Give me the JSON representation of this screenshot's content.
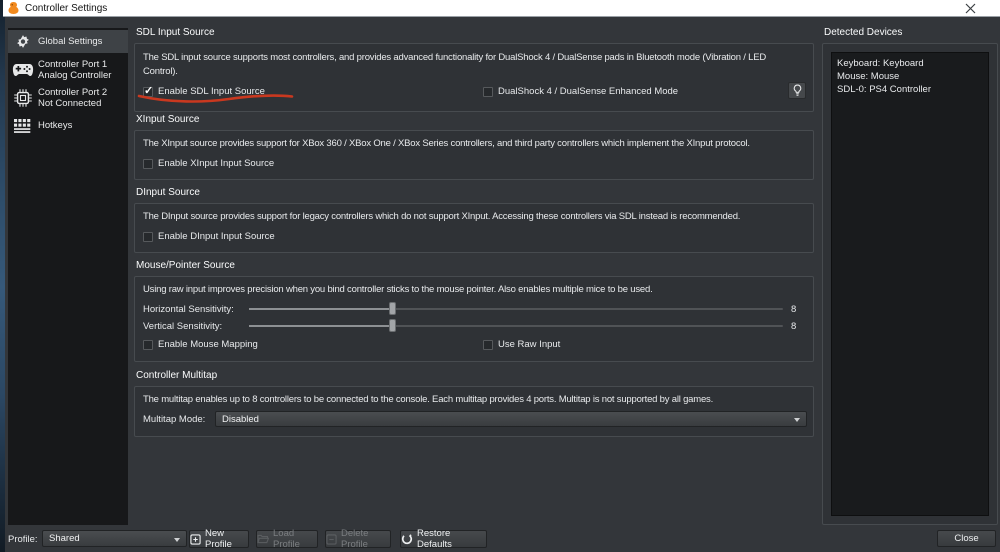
{
  "titlebar": {
    "title": "Controller Settings"
  },
  "colors": {
    "annotation_red": "#c9381f",
    "titlebar_bg": "#ffffff",
    "selection_bg": "#3e4246",
    "accent_orange": "#f28a1e"
  },
  "glyphs": {
    "check": "✓"
  },
  "sidebar": {
    "items": [
      {
        "label": "Global Settings",
        "icon": "gear-icon",
        "selected": true
      },
      {
        "label": "Controller Port 1",
        "sublabel": "Analog Controller",
        "icon": "gamepad-icon",
        "selected": false
      },
      {
        "label": "Controller Port 2",
        "sublabel": "Not Connected",
        "icon": "chip-icon",
        "selected": false
      },
      {
        "label": "Hotkeys",
        "icon": "hotkeys-icon",
        "selected": false
      }
    ]
  },
  "sdl": {
    "heading": "SDL Input Source",
    "description": "The SDL input source supports most controllers, and provides advanced functionality for DualShock 4 / DualSense pads in Bluetooth mode (Vibration / LED Control).",
    "enable_label": "Enable SDL Input Source",
    "enable_checked": true,
    "enhanced_label": "DualShock 4 / DualSense Enhanced Mode",
    "enhanced_checked": false
  },
  "xinput": {
    "heading": "XInput Source",
    "description": "The XInput source provides support for XBox 360 / XBox One / XBox Series controllers, and third party controllers which implement the XInput protocol.",
    "enable_label": "Enable XInput Input Source",
    "enable_checked": false
  },
  "dinput": {
    "heading": "DInput Source",
    "description": "The DInput source provides support for legacy controllers which do not support XInput. Accessing these controllers via SDL instead is recommended.",
    "enable_label": "Enable DInput Input Source",
    "enable_checked": false
  },
  "mouse": {
    "heading": "Mouse/Pointer Source",
    "description": "Using raw input improves precision when you bind controller sticks to the mouse pointer. Also enables multiple mice to be used.",
    "horizontal_label": "Horizontal Sensitivity:",
    "horizontal_value": "8",
    "vertical_label": "Vertical Sensitivity:",
    "vertical_value": "8",
    "slider_percent": 27,
    "mapping_label": "Enable Mouse Mapping",
    "mapping_checked": false,
    "raw_label": "Use Raw Input",
    "raw_checked": false
  },
  "multitap": {
    "heading": "Controller Multitap",
    "description": "The multitap enables up to 8 controllers to be connected to the console. Each multitap provides 4 ports. Multitap is not supported by all games.",
    "mode_label": "Multitap Mode:",
    "mode_value": "Disabled"
  },
  "devices": {
    "heading": "Detected Devices",
    "items": [
      "Keyboard: Keyboard",
      "Mouse: Mouse",
      "SDL-0: PS4 Controller"
    ]
  },
  "footer": {
    "profile_label": "Profile:",
    "profile_value": "Shared",
    "new_profile_label": "New Profile",
    "load_profile_label": "Load Profile",
    "delete_profile_label": "Delete Profile",
    "restore_defaults_label": "Restore Defaults",
    "close_label": "Close"
  }
}
